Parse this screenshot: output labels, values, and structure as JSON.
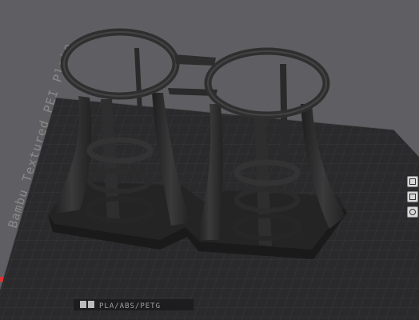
{
  "viewport": {
    "bed": {
      "name": "Bambu Textured PEI Plate",
      "spec_label": "PLA/ABS/PETG"
    },
    "model": {
      "name_icon": "twin-cup-holder-model"
    },
    "colors": {
      "background": "#5f5f63",
      "plate": "#2a2a2c",
      "grid": "#3a3a3d",
      "model": "#2b2b2b"
    }
  },
  "side_toolbar": {
    "items": [
      "view-front-icon",
      "view-top-icon",
      "orient-icon"
    ]
  }
}
